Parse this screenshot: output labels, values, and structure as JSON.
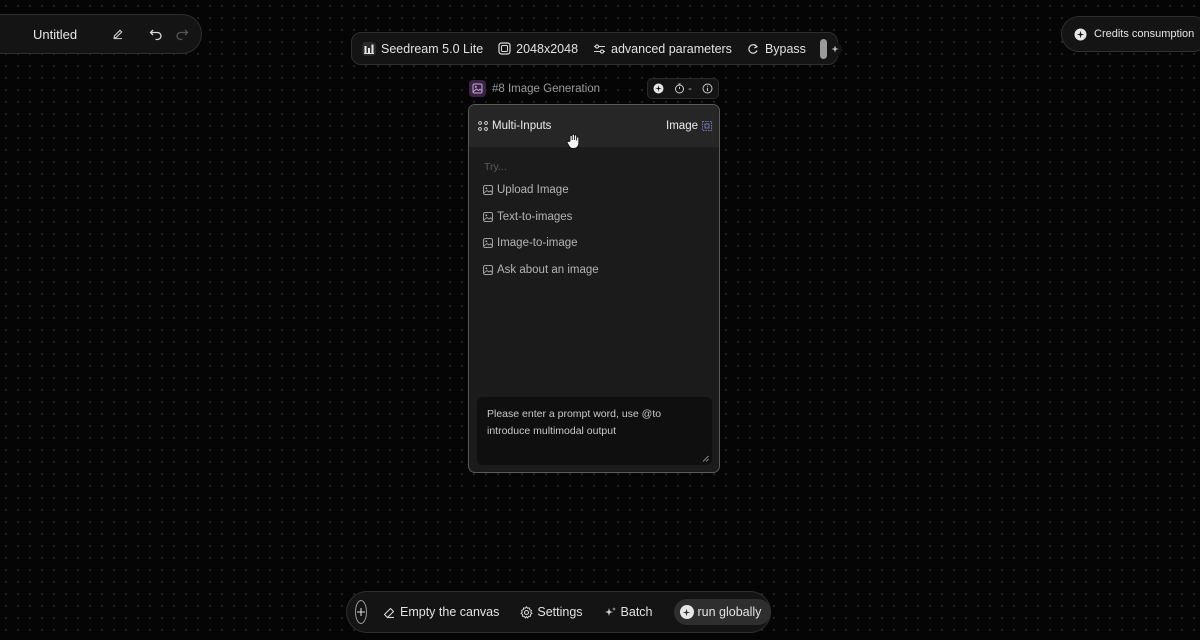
{
  "title_bar": {
    "title": "Untitled",
    "icons": [
      "edit-icon",
      "undo-icon",
      "redo-icon"
    ]
  },
  "top_toolbar": {
    "model": "Seedream 5.0 Lite",
    "resolution": "2048x2048",
    "advanced": "advanced parameters",
    "bypass": "Bypass"
  },
  "credits": {
    "label": "Credits consumption"
  },
  "node": {
    "label": "#8 Image Generation",
    "timer_value": "-",
    "header_left": "Multi-Inputs",
    "header_right": "Image",
    "try_label": "Try...",
    "suggestions": [
      {
        "label": "Upload Image"
      },
      {
        "label": "Text-to-images"
      },
      {
        "label": "Image-to-image"
      },
      {
        "label": "Ask about an image"
      }
    ],
    "prompt_placeholder": "Please enter a prompt word, use @to introduce multimodal output"
  },
  "bottom_toolbar": {
    "empty_canvas": "Empty the canvas",
    "settings": "Settings",
    "batch": "Batch",
    "run_globally": "run globally"
  },
  "colors": {
    "background": "#050505",
    "panel": "#141414",
    "card": "#1b1b1b",
    "node_icon_bg": "#3a2244"
  }
}
